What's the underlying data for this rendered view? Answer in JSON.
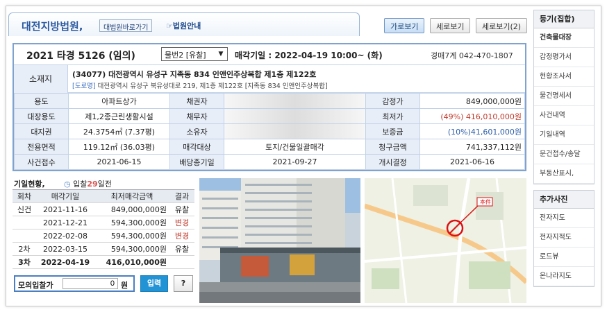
{
  "header": {
    "court_name": "대전지방법원,",
    "court_link": "대법원바로가기",
    "court_info": "법원안내",
    "views": [
      "가로보기",
      "세로보기",
      "세로보기(2)"
    ]
  },
  "case": {
    "number": "2021 타경 5126 (임의)",
    "item_select": "물번2 [유찰]",
    "sale_date": "매각기일 : 2022-04-19 10:00~ (화)",
    "dept": "경매7계  042-470-1807"
  },
  "address": {
    "label": "소재지",
    "line1": "(34077) 대전광역시 유성구 지족동 834 인앤인주상복합 제1층 제122호",
    "road_tag": "[도로명]",
    "line2": "대전광역시 유성구 북유성대로 219, 제1층 제122호 [지족동 834 인앤인주상복합]"
  },
  "details": [
    [
      "용도",
      "아파트상가",
      "채권자",
      "",
      "감정가",
      "849,000,000원"
    ],
    [
      "대장용도",
      "제1,2종근린생활시설",
      "채무자",
      "",
      "최저가",
      "(49%) 416,010,000원"
    ],
    [
      "대지권",
      "24.3754㎡ (7.37평)",
      "소유자",
      "",
      "보증금",
      "(10%)41,601,000원"
    ],
    [
      "전용면적",
      "119.12㎡ (36.03평)",
      "매각대상",
      "토지/건물일괄매각",
      "청구금액",
      "741,337,112원"
    ],
    [
      "사건접수",
      "2021-06-15",
      "배당종기일",
      "2021-09-27",
      "개시결정",
      "2021-06-16"
    ]
  ],
  "bidding": {
    "title": "기일현황,",
    "subtitle_prefix": "입찰",
    "days": "29",
    "subtitle_suffix": "일전",
    "headers": [
      "회차",
      "매각기일",
      "최저매각금액",
      "결과"
    ],
    "rows": [
      [
        "신건",
        "2021-11-16",
        "849,000,000원",
        "유찰"
      ],
      [
        "",
        "2021-12-21",
        "594,300,000원",
        "변경"
      ],
      [
        "",
        "2022-02-08",
        "594,300,000원",
        "변경"
      ],
      [
        "2차",
        "2022-03-15",
        "594,300,000원",
        "유찰"
      ],
      [
        "3차",
        "2022-04-19",
        "416,010,000원",
        ""
      ]
    ],
    "mock_label": "모의입찰가",
    "mock_value": "0",
    "mock_unit": "원",
    "enter_label": "입력",
    "help_label": "?"
  },
  "map_marker": "本件",
  "sidebar": {
    "group1_title": "등기(집합)",
    "group1": [
      "건축물대장",
      "감정평가서",
      "현황조사서",
      "물건명세서",
      "사건내역",
      "기일내역",
      "문건접수/송달",
      "부동산표시,"
    ],
    "group2_title": "추가사진",
    "group2": [
      "전자지도",
      "전자지적도",
      "로드뷰",
      "온나라지도"
    ]
  },
  "colors": {
    "accent": "#2c5aa0",
    "changed": "#c0392b",
    "deposit": "#2a5ca8",
    "enter_button": "#2293d4"
  }
}
